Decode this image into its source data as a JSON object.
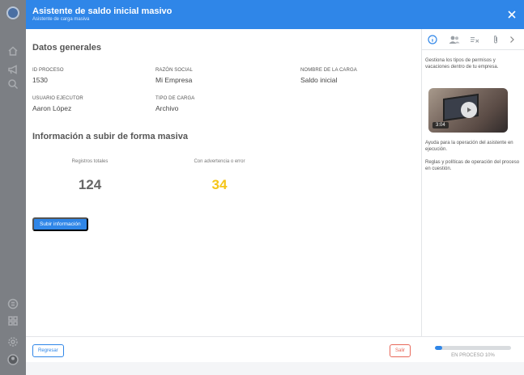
{
  "rail": {
    "icons": [
      "logo-icon",
      "home-icon",
      "megaphone-icon",
      "search-icon",
      "payroll-icon",
      "grid-icon",
      "settings-icon",
      "user-avatar-icon"
    ]
  },
  "header": {
    "title": "Asistente de saldo inicial masivo",
    "subtitle": "Asistente de carga masiva"
  },
  "general": {
    "title": "Datos generales",
    "fields": [
      {
        "label": "ID PROCESO",
        "value": "1530"
      },
      {
        "label": "RAZÓN SOCIAL",
        "value": "Mi Empresa"
      },
      {
        "label": "NOMBRE DE LA CARGA",
        "value": "Saldo inicial"
      },
      {
        "label": "USUARIO EJECUTOR",
        "value": "Aaron López"
      },
      {
        "label": "TIPO DE CARGA",
        "value": "Archivo"
      }
    ]
  },
  "upload": {
    "title": "Información a subir de forma masiva",
    "stats": [
      {
        "label": "Registros totales",
        "value": "124",
        "color": "#666666"
      },
      {
        "label": "Con advertencia o error",
        "value": "34",
        "color": "#f5c518"
      }
    ],
    "button_label": "Subir información"
  },
  "panel": {
    "tabs": [
      "info-icon",
      "users-icon",
      "list-check-icon",
      "attachment-icon",
      "chevron-right-icon"
    ],
    "description": "Gestiona los tipos de permisos y vacaciones dentro de tu empresa.",
    "video_duration": "3:04",
    "help_text": "Ayuda para la operación del asistente en ejecución.",
    "rules_text": "Reglas y políticas de operación del proceso en cuestión."
  },
  "footer": {
    "back_label": "Regresar",
    "exit_label": "Salir",
    "progress_percent": 10,
    "progress_text": "EN PROCESO 10%"
  },
  "colors": {
    "accent": "#2f86e8",
    "warning": "#f5c518",
    "danger": "#e8685a"
  }
}
